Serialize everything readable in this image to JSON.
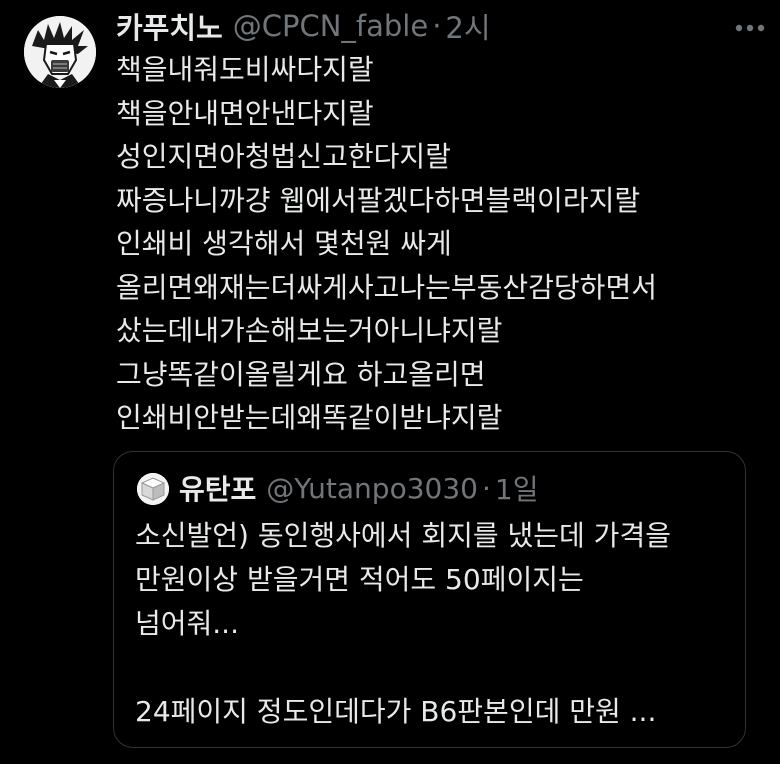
{
  "tweet": {
    "author": {
      "display_name": "카푸치노",
      "handle": "@CPCN_fable",
      "separator": "·",
      "time": "2시",
      "avatar_icon": "manga-character-avatar"
    },
    "more_icon": "more-horizontal-icon",
    "text_lines": [
      "책을내줘도비싸다지랄",
      "책을안내면안낸다지랄",
      "성인지면아청법신고한다지랄",
      "짜증나니까걍 웹에서팔겠다하면블랙이라지랄",
      "인쇄비 생각해서 몇천원 싸게",
      "올리면왜재는더싸게사고나는부동산감당하면서",
      "샀는데내가손해보는거아니냐지랄",
      "그냥똑같이올릴게요 하고올리면",
      "인쇄비안받는데왜똑같이받냐지랄"
    ]
  },
  "quote": {
    "author": {
      "display_name": "유탄포",
      "handle": "@Yutanpo3030",
      "separator": "·",
      "time": "1일",
      "avatar_icon": "white-cube-avatar"
    },
    "text_lines": [
      "소신발언) 동인행사에서 회지를 냈는데 가격을",
      "만원이상 받을거면 적어도 50페이지는",
      "넘어줘...",
      "",
      "24페이지 정도인데다가 B6판본인데 만원 ..."
    ]
  },
  "colors": {
    "background": "#000000",
    "text_primary": "#e7e9ea",
    "text_secondary": "#71767b",
    "border": "#2f3336"
  }
}
